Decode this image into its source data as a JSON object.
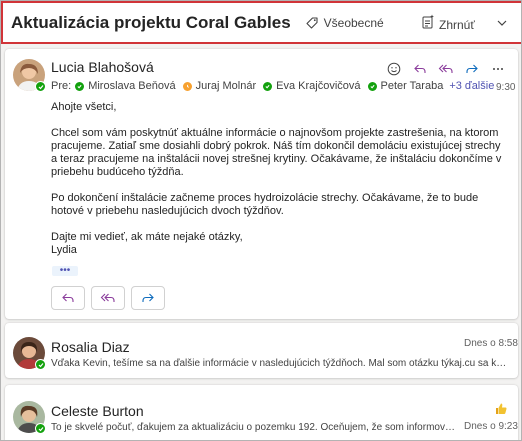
{
  "header": {
    "subject": "Aktualizácia projektu Coral Gables",
    "tag_label": "Všeobecné",
    "summarize_label": "Zhrnúť"
  },
  "message1": {
    "sender": "Lucia Blahošová",
    "to_prefix": "Pre:",
    "recipients": [
      {
        "name": "Miroslava Beňová",
        "status": "available"
      },
      {
        "name": "Juraj Molnár",
        "status": "away"
      },
      {
        "name": "Eva Krajčovičová",
        "status": "available"
      },
      {
        "name": "Peter Taraba",
        "status": "available"
      }
    ],
    "more_recipients": "+3 ďalšie",
    "time": "9:30",
    "body": [
      "Ahojte všetci,",
      "Chcel som vám poskytnúť aktuálne informácie o najnovšom projekte zastrešenia, na ktorom pracujeme. Zatiaľ sme dosiahli dobrý pokrok. Náš tím dokončil demoláciu existujúcej strechy a teraz pracujeme na inštalácii novej strešnej krytiny. Očakávame, že inštaláciu dokončíme v priebehu budúceho týždňa.",
      "Po dokončení inštalácie začneme proces hydroizolácie strechy. Očakávame, že to bude hotové v priebehu nasledujúcich dvoch týždňov.",
      "Dajte mi vedieť, ak máte nejaké otázky,",
      "Lydia"
    ],
    "ellipsis": "•••"
  },
  "message2": {
    "sender": "Rosalia Diaz",
    "time": "Dnes o 8:58",
    "preview": "Vďaka Kevin, tešíme sa na ďalšie informácie v nasledujúcich týždňoch. Mal som otázku týkaj.cu sa konečných nákladov"
  },
  "message3": {
    "sender": "Celeste Burton",
    "time": "Dnes o 9:23",
    "preview": "To je skvelé počuť, ďakujem za aktualizáciu o pozemku 192. Oceňujem, že som informovaný o priebehu projektu."
  },
  "colors": {
    "accent": "#5b5fc7",
    "available": "#13a10e",
    "away": "#f7a130",
    "header_border": "#d13438"
  }
}
